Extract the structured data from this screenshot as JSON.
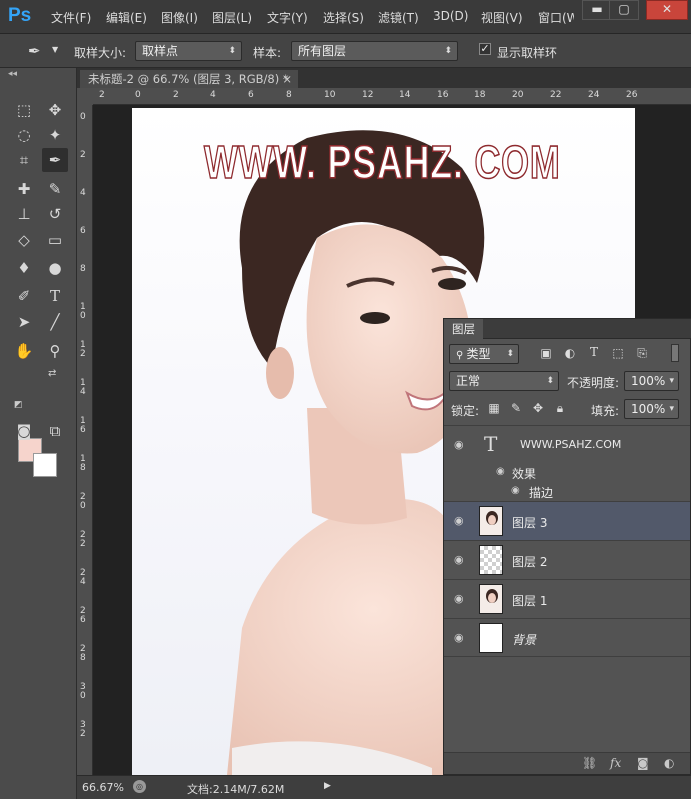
{
  "app": {
    "logo": "Ps"
  },
  "menu": [
    "文件(F)",
    "编辑(E)",
    "图像(I)",
    "图层(L)",
    "文字(Y)",
    "选择(S)",
    "滤镜(T)",
    "3D(D)",
    "视图(V)",
    "窗口(W)"
  ],
  "window_controls": {
    "minimize": "▬",
    "maximize": "▢",
    "close": "✕"
  },
  "options": {
    "sample_size_label": "取样大小:",
    "sample_size_value": "取样点",
    "sample_label": "样本:",
    "sample_value": "所有图层",
    "show_ring_label": "显示取样环",
    "show_ring_checked": true
  },
  "document": {
    "tab_title": "未标题-2 @ 66.7% (图层 3, RGB/8) *",
    "watermark_text": "WWW. PSAHZ. COM",
    "ruler_top_ticks": [
      "2",
      "0",
      "2",
      "4",
      "6",
      "8",
      "10",
      "12",
      "14",
      "16",
      "18",
      "20",
      "22",
      "24",
      "26"
    ],
    "ruler_left_ticks": [
      "0",
      "2",
      "4",
      "6",
      "8",
      "1 0",
      "1 2",
      "1 4",
      "1 6",
      "1 8",
      "2 0",
      "2 2",
      "2 4",
      "2 6",
      "2 8",
      "3 0",
      "3 2"
    ]
  },
  "status": {
    "zoom": "66.67%",
    "doc_info": "文档:2.14M/7.62M"
  },
  "colors": {
    "foreground": "#f6d4cc",
    "background": "#ffffff",
    "watermark_stroke": "#8e2a2e",
    "selected_layer": "#52596a"
  },
  "layers_panel": {
    "tab": "图层",
    "filter_kind": "类型",
    "blend_mode": "正常",
    "opacity_label": "不透明度:",
    "opacity_value": "100%",
    "lock_label": "锁定:",
    "fill_label": "填充:",
    "fill_value": "100%",
    "layers": [
      {
        "name": "WWW.PSAHZ.COM",
        "kind": "text",
        "effects_label": "效果",
        "effect": "描边"
      },
      {
        "name": "图层 3",
        "kind": "photo",
        "selected": true
      },
      {
        "name": "图层 2",
        "kind": "transparent"
      },
      {
        "name": "图层 1",
        "kind": "photo"
      },
      {
        "name": "背景",
        "kind": "background"
      }
    ]
  }
}
